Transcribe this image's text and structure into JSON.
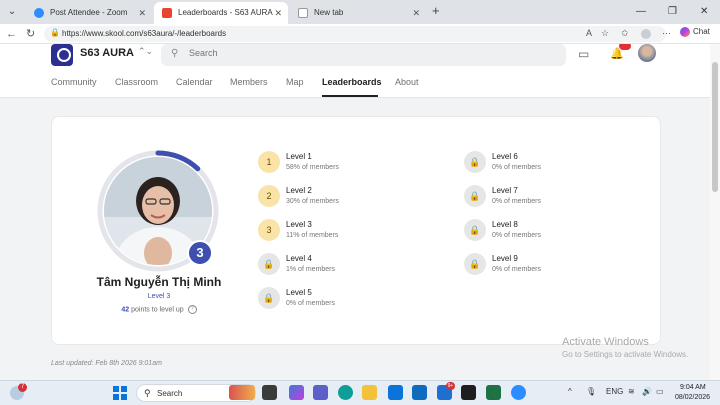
{
  "browser": {
    "tabs": [
      {
        "title": "Post Attendee - Zoom",
        "icon": "zoom-icon",
        "color": "#2d8cff"
      },
      {
        "title": "Leaderboards - S63 AURA",
        "icon": "skool-icon",
        "color": "#e8452c"
      },
      {
        "title": "New tab",
        "icon": "newtab-icon",
        "color": "#6b7280"
      }
    ],
    "url": "https://www.skool.com/s63aura/-/leaderboards",
    "chat_label": "Chat"
  },
  "site": {
    "name": "S63 AURA",
    "search_placeholder": "Search",
    "nav": [
      "Community",
      "Classroom",
      "Calendar",
      "Members",
      "Map",
      "Leaderboards",
      "About"
    ],
    "active_nav": "Leaderboards"
  },
  "profile": {
    "name": "Tâm Nguyễn Thị Minh",
    "level_label": "Level 3",
    "level_number": "3",
    "points_to_level_up": "42",
    "points_suffix": "points to level up",
    "progress_fraction": 0.12
  },
  "levels": [
    {
      "number": "1",
      "name": "Level 1",
      "pct": "58% of members",
      "locked": false
    },
    {
      "number": "2",
      "name": "Level 2",
      "pct": "30% of members",
      "locked": false
    },
    {
      "number": "3",
      "name": "Level 3",
      "pct": "11% of members",
      "locked": false
    },
    {
      "number": "4",
      "name": "Level 4",
      "pct": "1% of members",
      "locked": true
    },
    {
      "number": "5",
      "name": "Level 5",
      "pct": "0% of members",
      "locked": true
    },
    {
      "number": "6",
      "name": "Level 6",
      "pct": "0% of members",
      "locked": true
    },
    {
      "number": "7",
      "name": "Level 7",
      "pct": "0% of members",
      "locked": true
    },
    {
      "number": "8",
      "name": "Level 8",
      "pct": "0% of members",
      "locked": true
    },
    {
      "number": "9",
      "name": "Level 9",
      "pct": "0% of members",
      "locked": true
    }
  ],
  "last_updated": "Last updated: Feb 8th 2026 9:01am",
  "watermark": {
    "title": "Activate Windows",
    "subtitle": "Go to Settings to activate Windows."
  },
  "taskbar": {
    "search_label": "Search",
    "weather_badge": "7",
    "mail_badge": "9+",
    "lang": "ENG",
    "time": "9:04 AM",
    "date": "08/02/2026"
  },
  "colors": {
    "accent": "#3e4fb0",
    "unlocked": "#f9e3a7",
    "locked": "#e6e6e6"
  }
}
